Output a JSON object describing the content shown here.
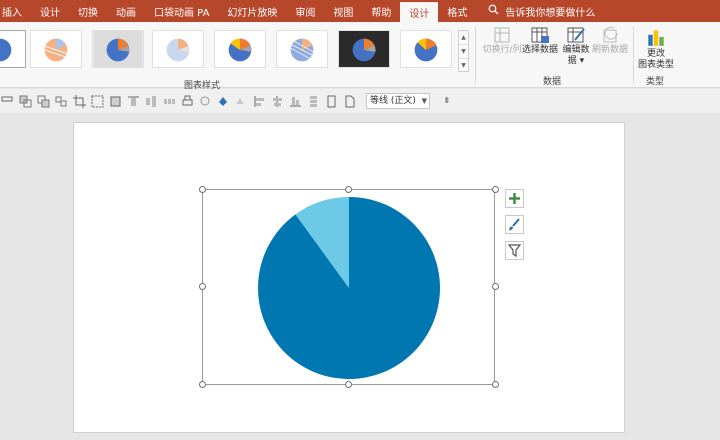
{
  "tabs": [
    {
      "label": "插入"
    },
    {
      "label": "设计"
    },
    {
      "label": "切换"
    },
    {
      "label": "动画"
    },
    {
      "label": "口袋动画 PA"
    },
    {
      "label": "幻灯片放映"
    },
    {
      "label": "审阅"
    },
    {
      "label": "视图"
    },
    {
      "label": "帮助"
    },
    {
      "label": "设计",
      "active": true
    },
    {
      "label": "格式"
    }
  ],
  "tell_me": "告诉我你想要做什么",
  "ribbon": {
    "chart_styles_label": "图表样式",
    "data_group_label": "数据",
    "type_group_label": "类型",
    "buttons": {
      "switch_row_col": "切换行/列",
      "select_data": "选择数据",
      "edit_data_line1": "编辑数",
      "edit_data_line2": "据 ▾",
      "refresh_data": "刷新数据",
      "change_type_line1": "更改",
      "change_type_line2": "图表类型"
    }
  },
  "toolbar": {
    "font_name": "等线 (正文)"
  },
  "chart_data": {
    "type": "pie",
    "values": [
      90,
      10
    ],
    "colors": [
      "#0077b0",
      "#6dcae6"
    ]
  },
  "colors": {
    "accent": "#b7472a"
  }
}
